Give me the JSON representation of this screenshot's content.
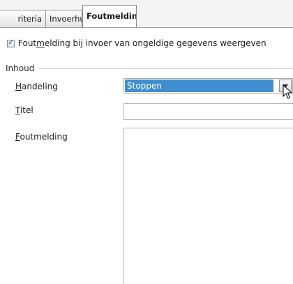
{
  "tabs": [
    {
      "label": "riteria"
    },
    {
      "label": "Invoerhulp"
    },
    {
      "label": "Foutmelding",
      "selected": true
    }
  ],
  "show_error": {
    "checked": true,
    "label_pre": "Fout",
    "label_mnemonic": "m",
    "label_post": "elding bij invoer van ongeldige gegevens weergeven"
  },
  "contents_group": {
    "label": "Inhoud"
  },
  "action": {
    "label_mnemonic": "H",
    "label_rest": "andeling",
    "selected_value": "Stoppen"
  },
  "title": {
    "label_mnemonic": "T",
    "label_rest": "itel",
    "value": ""
  },
  "error_message": {
    "label_mnemonic": "F",
    "label_rest": "outmelding",
    "value": ""
  },
  "colors": {
    "selection": "#3f8ecf",
    "accent_check": "#2b4f86"
  }
}
